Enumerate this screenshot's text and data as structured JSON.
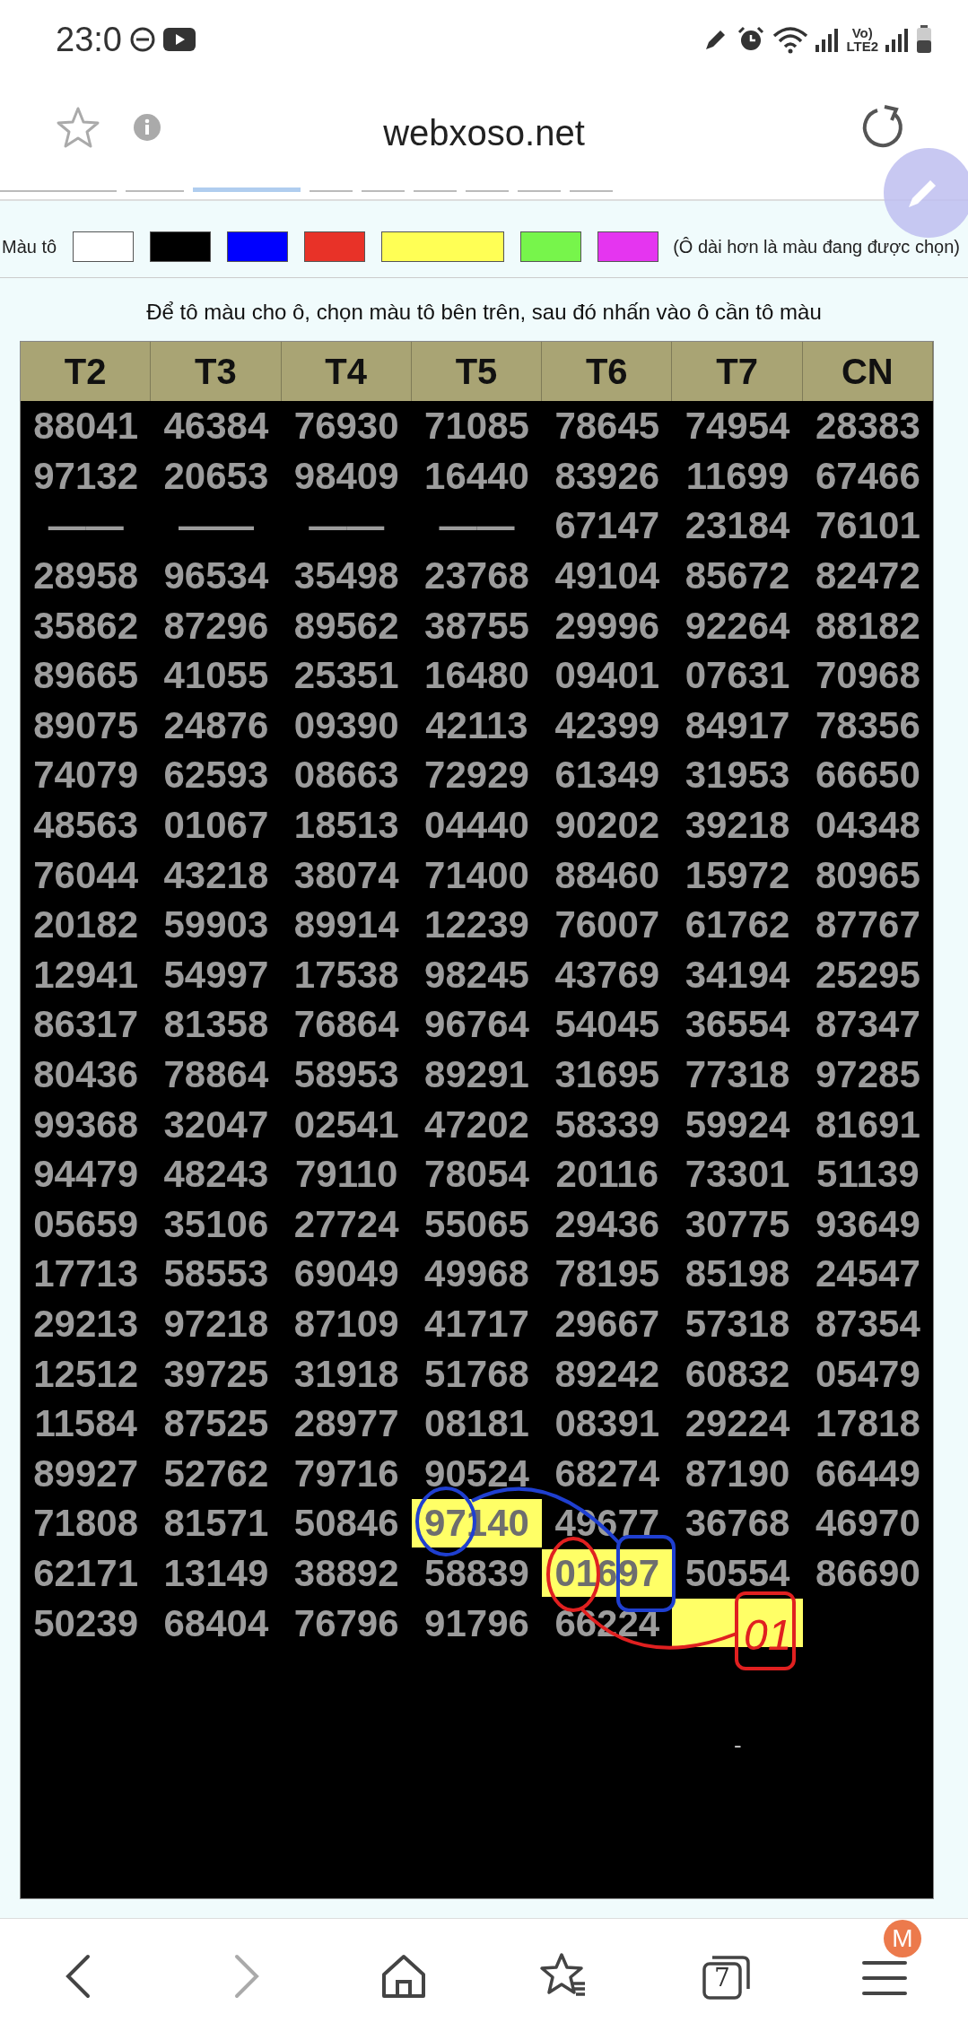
{
  "status_bar": {
    "time": "23:0",
    "network_label": [
      "Vo)",
      "LTE2"
    ]
  },
  "address_bar": {
    "title": "webxoso.net"
  },
  "palette": {
    "label": "Màu tô",
    "note": "(Ô dài hơn là màu đang được chọn)",
    "swatches": [
      {
        "color": "#ffffff",
        "selected": false
      },
      {
        "color": "#000000",
        "selected": false
      },
      {
        "color": "#0000ff",
        "selected": false
      },
      {
        "color": "#e83228",
        "selected": false
      },
      {
        "color": "#ffff55",
        "selected": true
      },
      {
        "color": "#77f54b",
        "selected": false
      },
      {
        "color": "#e535f0",
        "selected": false
      }
    ]
  },
  "instruction": "Để tô màu cho ô, chọn màu tô bên trên, sau đó nhấn vào ô cần tô màu",
  "table": {
    "columns": [
      "T2",
      "T3",
      "T4",
      "T5",
      "T6",
      "T7",
      "CN"
    ],
    "rows": [
      [
        "88041",
        "46384",
        "76930",
        "71085",
        "78645",
        "74954",
        "28383"
      ],
      [
        "97132",
        "20653",
        "98409",
        "16440",
        "83926",
        "11699",
        "67466"
      ],
      [
        "——",
        "——",
        "——",
        "——",
        "67147",
        "23184",
        "76101"
      ],
      [
        "28958",
        "96534",
        "35498",
        "23768",
        "49104",
        "85672",
        "82472"
      ],
      [
        "35862",
        "87296",
        "89562",
        "38755",
        "29996",
        "92264",
        "88182"
      ],
      [
        "89665",
        "41055",
        "25351",
        "16480",
        "09401",
        "07631",
        "70968"
      ],
      [
        "89075",
        "24876",
        "09390",
        "42113",
        "42399",
        "84917",
        "78356"
      ],
      [
        "74079",
        "62593",
        "08663",
        "72929",
        "61349",
        "31953",
        "66650"
      ],
      [
        "48563",
        "01067",
        "18513",
        "04440",
        "90202",
        "39218",
        "04348"
      ],
      [
        "76044",
        "43218",
        "38074",
        "71400",
        "88460",
        "15972",
        "80965"
      ],
      [
        "20182",
        "59903",
        "89914",
        "12239",
        "76007",
        "61762",
        "87767"
      ],
      [
        "12941",
        "54997",
        "17538",
        "98245",
        "43769",
        "34194",
        "25295"
      ],
      [
        "86317",
        "81358",
        "76864",
        "96764",
        "54045",
        "36554",
        "87347"
      ],
      [
        "80436",
        "78864",
        "58953",
        "89291",
        "31695",
        "77318",
        "97285"
      ],
      [
        "99368",
        "32047",
        "02541",
        "47202",
        "58339",
        "59924",
        "81691"
      ],
      [
        "94479",
        "48243",
        "79110",
        "78054",
        "20116",
        "73301",
        "51139"
      ],
      [
        "05659",
        "35106",
        "27724",
        "55065",
        "29436",
        "30775",
        "93649"
      ],
      [
        "17713",
        "58553",
        "69049",
        "49968",
        "78195",
        "85198",
        "24547"
      ],
      [
        "29213",
        "97218",
        "87109",
        "41717",
        "29667",
        "57318",
        "87354"
      ],
      [
        "12512",
        "39725",
        "31918",
        "51768",
        "89242",
        "60832",
        "05479"
      ],
      [
        "11584",
        "87525",
        "28977",
        "08181",
        "08391",
        "29224",
        "17818"
      ],
      [
        "89927",
        "52762",
        "79716",
        "90524",
        "68274",
        "87190",
        "66449"
      ],
      [
        "71808",
        "81571",
        "50846",
        {
          "text": "97140",
          "color": "#ffff66"
        },
        "49677",
        "36768",
        "46970"
      ],
      [
        "62171",
        "13149",
        "38892",
        "58839",
        {
          "text": "01697",
          "color": "#ffff66"
        },
        "50554",
        "86690"
      ],
      [
        "50239",
        "68404",
        "76796",
        "91796",
        "66224",
        {
          "color": "#ffff66"
        }
      ]
    ],
    "handwritten_note": "01",
    "stray_mark": "-"
  },
  "bottom_nav": {
    "tab_count": "7",
    "account_badge": "M"
  }
}
